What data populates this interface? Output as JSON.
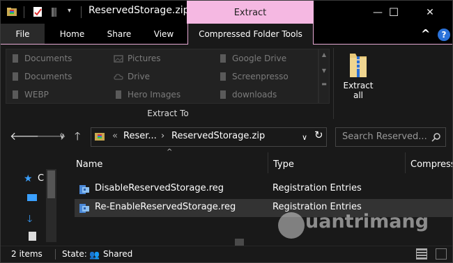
{
  "window": {
    "title": "ReservedStorage.zip",
    "context_tab": "Extract",
    "controls": {
      "minimize": "—",
      "maximize": "☐",
      "close": "✕"
    }
  },
  "ribbon": {
    "tabs": [
      "File",
      "Home",
      "Share",
      "View",
      "Compressed Folder Tools"
    ],
    "collapse_glyph": "^",
    "help_glyph": "?",
    "extract_to": {
      "items": [
        [
          "Documents",
          "Pictures",
          "Google Drive"
        ],
        [
          "Documents",
          "Drive",
          "Screenpresso"
        ],
        [
          "WEBP",
          "Hero Images",
          "downloads"
        ]
      ],
      "group_label": "Extract To"
    },
    "extract_all": {
      "line1": "Extract",
      "line2": "all"
    }
  },
  "navigation": {
    "breadcrumb_overflow": "«",
    "breadcrumb": [
      "Reser...",
      "ReservedStorage.zip"
    ],
    "search_placeholder": "Search Reserved..."
  },
  "nav_pane": {
    "quick_access_label": "C"
  },
  "file_list": {
    "columns": [
      "Name",
      "Type",
      "Compress"
    ],
    "rows": [
      {
        "name": "DisableReservedStorage.reg",
        "type": "Registration Entries"
      },
      {
        "name": "Re-EnableReservedStorage.reg",
        "type": "Registration Entries"
      }
    ]
  },
  "status_bar": {
    "items": "2 items",
    "state_label": "State:",
    "state_value": "Shared"
  },
  "watermark": "uantrimang"
}
